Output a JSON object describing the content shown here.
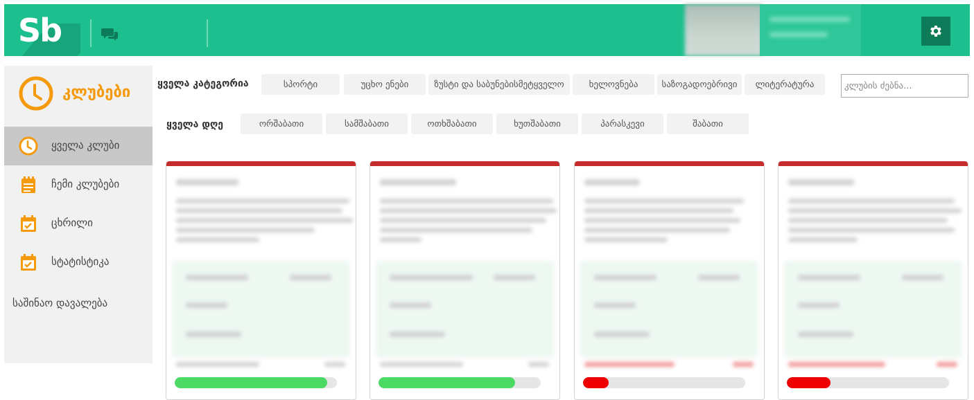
{
  "header": {
    "logo_text": "Sb",
    "chat_icon": "chat-bubbles-icon",
    "settings_icon": "gear-icon",
    "accent_color": "#1dbf8e"
  },
  "sidebar": {
    "brand_label": "კლუბები",
    "brand_icon": "clock-icon",
    "brand_color": "#f49a0c",
    "items": [
      {
        "label": "ყველა კლუბი",
        "icon": "clock-icon",
        "active": true
      },
      {
        "label": "ჩემი კლუბები",
        "icon": "notepad-icon",
        "active": false
      },
      {
        "label": "ცხრილი",
        "icon": "calendar-check-icon",
        "active": false
      },
      {
        "label": "სტატისტიკა",
        "icon": "calendar-check-icon",
        "active": false
      }
    ],
    "homework_label": "საშინაო დავალება"
  },
  "filters": {
    "category_label": "ყველა კატეგორია",
    "categories": [
      "სპორტი",
      "უცხო ენები",
      "ზუსტი და საბუნებისმეტყველო",
      "ხელოვნება",
      "საზოგადოებრივი",
      "ლიტერატურა"
    ],
    "day_label": "ყველა დღე",
    "days": [
      "ორშაბათი",
      "სამშაბათი",
      "ოთხშაბათი",
      "ხუთშაბათი",
      "პარასკევი",
      "შაბათი"
    ],
    "search_placeholder": "კლუბის ძებნა..."
  },
  "cards": [
    {
      "progress": 0.94,
      "bar_color": "#4cd964"
    },
    {
      "progress": 0.84,
      "bar_color": "#4cd964"
    },
    {
      "progress": 0.16,
      "bar_color": "#ee0000"
    },
    {
      "progress": 0.27,
      "bar_color": "#ee0000"
    }
  ]
}
